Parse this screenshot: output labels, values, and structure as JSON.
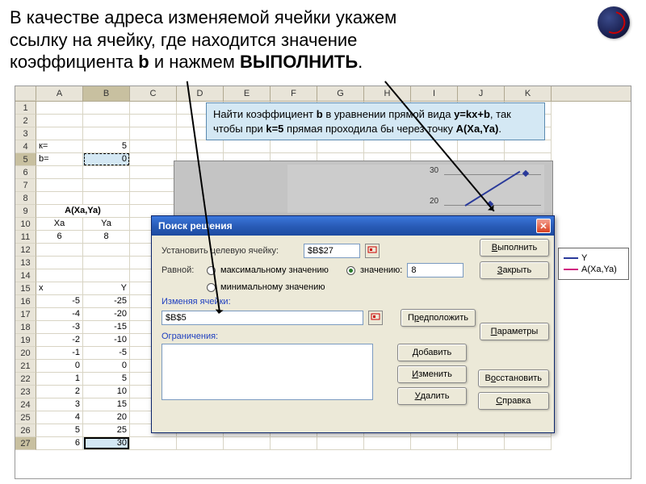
{
  "header": {
    "line1": "В качестве адреса изменяемой ячейки укажем",
    "line2": "ссылку на ячейку, где находится значение",
    "line3a": "коэффициента ",
    "bold_b": "b",
    "line3b": " и нажмем ",
    "bold_exec": "ВЫПОЛНИТЬ",
    "dot": "."
  },
  "columns": [
    "A",
    "B",
    "C",
    "D",
    "E",
    "F",
    "G",
    "H",
    "I",
    "J",
    "K"
  ],
  "row_labels": [
    "1",
    "2",
    "3",
    "4",
    "5",
    "6",
    "7",
    "8",
    "9",
    "10",
    "11",
    "12",
    "13",
    "14",
    "15",
    "16",
    "17",
    "18",
    "19",
    "20",
    "21",
    "22",
    "23",
    "24",
    "25",
    "26",
    "27"
  ],
  "cells": {
    "A4": "к=",
    "B4": "5",
    "A5": "b=",
    "B5": "0",
    "A9": "A(Xa,Ya)",
    "A10": "Xa",
    "B10": "Ya",
    "A11": "6",
    "B11": "8",
    "A15": "x",
    "B15": "Y",
    "A16": "-5",
    "B16": "-25",
    "A17": "-4",
    "B17": "-20",
    "A18": "-3",
    "B18": "-15",
    "A19": "-2",
    "B19": "-10",
    "A20": "-1",
    "B20": "-5",
    "A21": "0",
    "B21": "0",
    "A22": "1",
    "B22": "5",
    "A23": "2",
    "B23": "10",
    "A24": "3",
    "B24": "15",
    "A25": "4",
    "B25": "20",
    "A26": "5",
    "B26": "25",
    "A27": "6",
    "B27": "30"
  },
  "task": {
    "t1": "Найти коэффициент ",
    "b1": "b",
    "t2": " в уравнении прямой вида ",
    "b2": "y=kx+b",
    "t3": ", так чтобы при ",
    "b3": "k=5",
    "t4": " прямая проходила бы через точку ",
    "b4": "A(Xa,Ya)",
    "t5": "."
  },
  "chart": {
    "ytick1": "30",
    "ytick2": "20",
    "legend_y": "Y",
    "legend_a": "A(Xa,Ya)"
  },
  "dialog": {
    "title": "Поиск решения",
    "target_label": "Установить целевую ячейку:",
    "target_value": "$B$27",
    "equal_label": "Равной:",
    "opt_max": "максимальному значению",
    "opt_val": "значению:",
    "opt_min": "минимальному значению",
    "val_input": "8",
    "changing_label": "Изменяя ячейки:",
    "changing_value": "$B$5",
    "constraints_label": "Ограничения:",
    "btn_execute": "Выполнить",
    "btn_close": "Закрыть",
    "btn_guess": "Предположить",
    "btn_params": "Параметры",
    "btn_add": "Добавить",
    "btn_change": "Изменить",
    "btn_delete": "Удалить",
    "btn_restore": "Восстановить",
    "btn_help": "Справка",
    "u_exec": "В",
    "u_close": "З",
    "u_guess": "р",
    "u_params": "П",
    "u_add": "Д",
    "u_change": "И",
    "u_del": "У",
    "u_rest": "о",
    "u_help": "С"
  }
}
